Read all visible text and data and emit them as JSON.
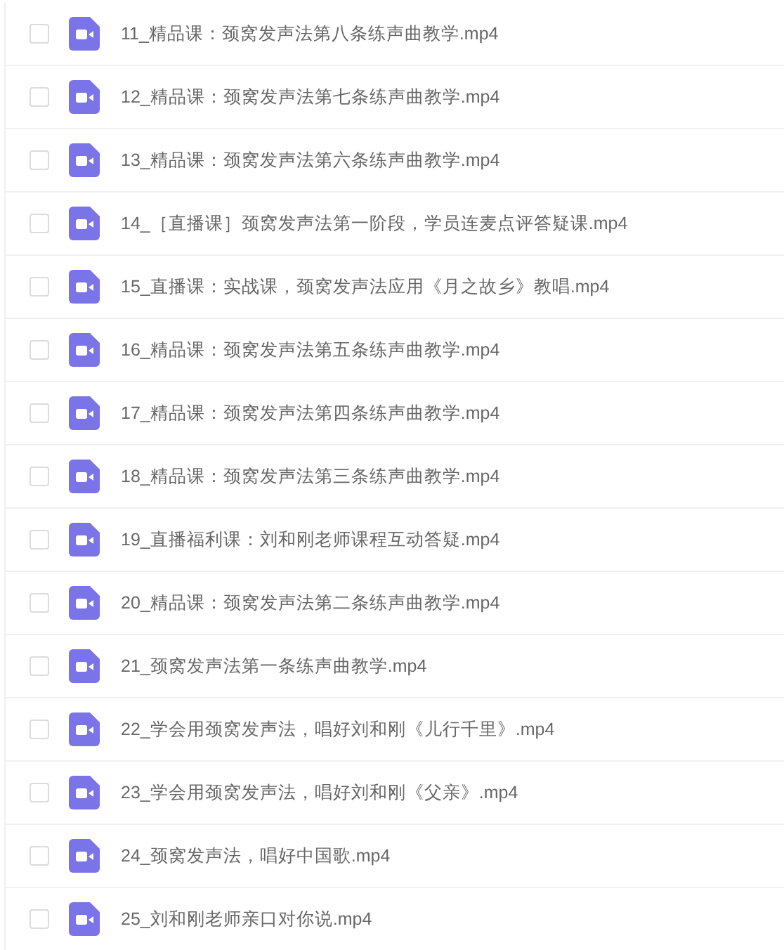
{
  "files": [
    {
      "name": "11_精品课：颈窝发声法第八条练声曲教学.mp4",
      "checked": false
    },
    {
      "name": "12_精品课：颈窝发声法第七条练声曲教学.mp4",
      "checked": false
    },
    {
      "name": "13_精品课：颈窝发声法第六条练声曲教学.mp4",
      "checked": false
    },
    {
      "name": "14_［直播课］颈窝发声法第一阶段，学员连麦点评答疑课.mp4",
      "checked": false
    },
    {
      "name": "15_直播课：实战课，颈窝发声法应用《月之故乡》教唱.mp4",
      "checked": false
    },
    {
      "name": "16_精品课：颈窝发声法第五条练声曲教学.mp4",
      "checked": false
    },
    {
      "name": "17_精品课：颈窝发声法第四条练声曲教学.mp4",
      "checked": false
    },
    {
      "name": "18_精品课：颈窝发声法第三条练声曲教学.mp4",
      "checked": false
    },
    {
      "name": "19_直播福利课：刘和刚老师课程互动答疑.mp4",
      "checked": false
    },
    {
      "name": "20_精品课：颈窝发声法第二条练声曲教学.mp4",
      "checked": false
    },
    {
      "name": "21_颈窝发声法第一条练声曲教学.mp4",
      "checked": false
    },
    {
      "name": "22_学会用颈窝发声法，唱好刘和刚《儿行千里》.mp4",
      "checked": false
    },
    {
      "name": "23_学会用颈窝发声法，唱好刘和刚《父亲》.mp4",
      "checked": false
    },
    {
      "name": "24_颈窝发声法，唱好中国歌.mp4",
      "checked": false
    },
    {
      "name": "25_刘和刚老师亲口对你说.mp4",
      "checked": false
    }
  ]
}
